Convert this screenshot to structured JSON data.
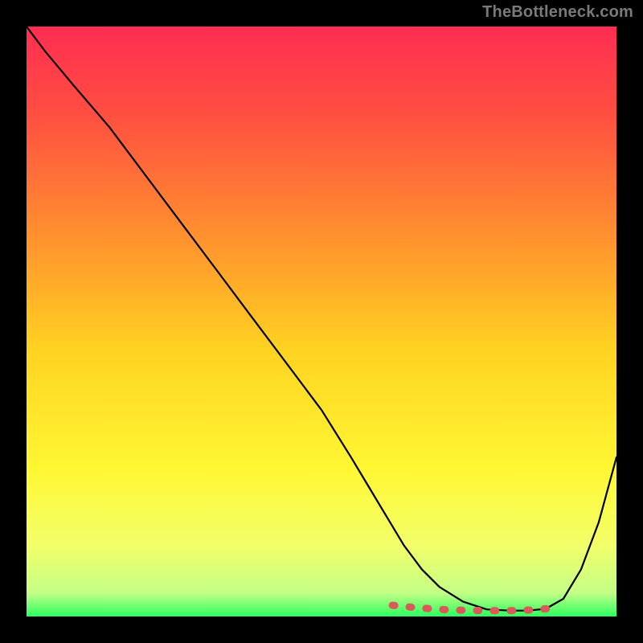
{
  "watermark": "TheBottleneck.com",
  "colors": {
    "frame": "#000000",
    "curve": "#000000",
    "optimal_band": "#d95a58",
    "gradient_stops": [
      {
        "offset": "0%",
        "color": "#ff2d52"
      },
      {
        "offset": "15%",
        "color": "#ff4f41"
      },
      {
        "offset": "35%",
        "color": "#ff8f2f"
      },
      {
        "offset": "55%",
        "color": "#ffd321"
      },
      {
        "offset": "75%",
        "color": "#fff733"
      },
      {
        "offset": "88%",
        "color": "#f2ff6a"
      },
      {
        "offset": "96%",
        "color": "#c4ff86"
      },
      {
        "offset": "100%",
        "color": "#2cff5f"
      }
    ]
  },
  "chart_data": {
    "type": "line",
    "title": "",
    "xlabel": "",
    "ylabel": "",
    "xlim": [
      0,
      100
    ],
    "ylim": [
      0,
      100
    ],
    "series": [
      {
        "name": "bottleneck-curve",
        "x": [
          0,
          3,
          8,
          14,
          20,
          26,
          32,
          38,
          44,
          50,
          55,
          58,
          61,
          64,
          67,
          70,
          74,
          78,
          82,
          85,
          88,
          91,
          94,
          97,
          100
        ],
        "y": [
          100,
          96,
          90,
          83,
          75,
          67,
          59,
          51,
          43,
          35,
          27,
          22,
          17,
          12,
          8,
          5,
          2.5,
          1.2,
          1.0,
          1.0,
          1.3,
          3,
          8,
          16,
          27
        ]
      },
      {
        "name": "optimal-range",
        "x": [
          62,
          66,
          70,
          74,
          78,
          82,
          86,
          89
        ],
        "y": [
          1.9,
          1.5,
          1.2,
          1.05,
          1.0,
          1.0,
          1.1,
          1.4
        ]
      }
    ]
  }
}
